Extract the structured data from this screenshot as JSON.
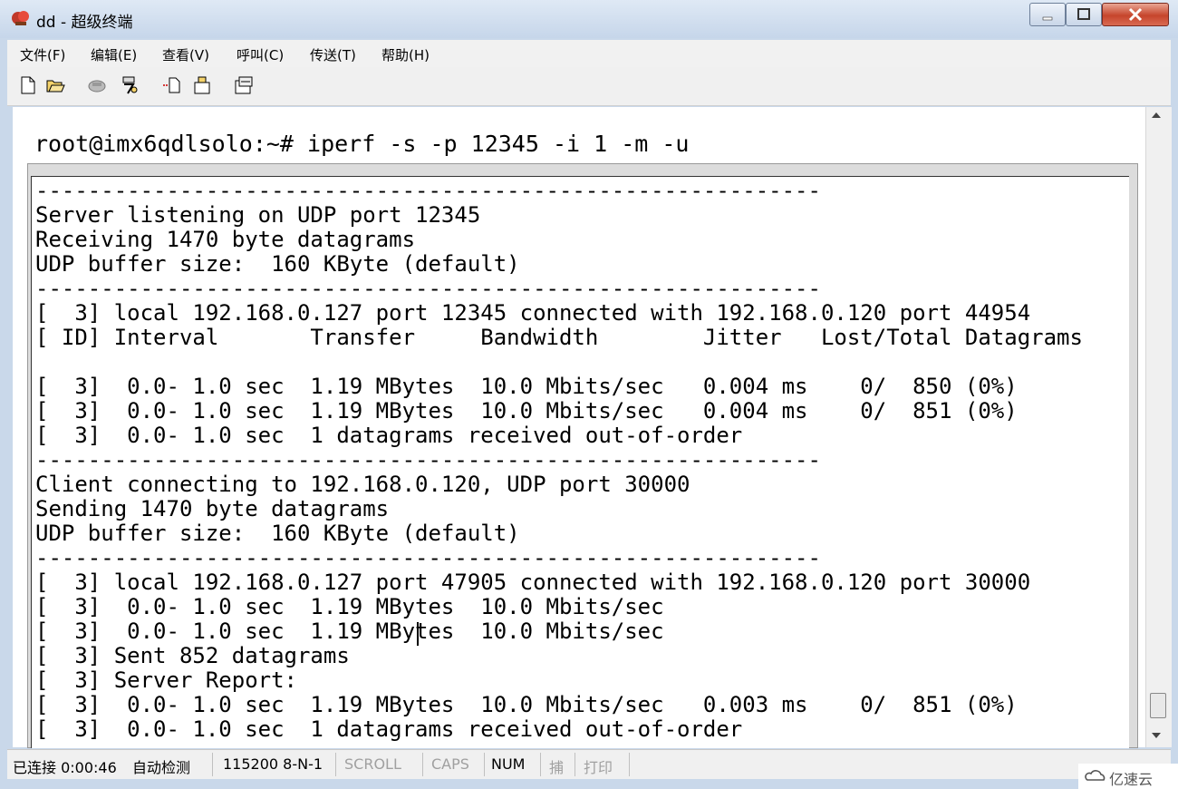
{
  "window": {
    "title": "dd - 超级终端"
  },
  "menu": [
    "文件(F)",
    "编辑(E)",
    "查看(V)",
    "呼叫(C)",
    "传送(T)",
    "帮助(H)"
  ],
  "toolbar_icons": [
    "new-icon",
    "open-icon",
    "disconnect-icon",
    "call-icon",
    "send-icon",
    "receive-icon",
    "properties-icon"
  ],
  "terminal": {
    "command_line": "root@imx6qdlsolo:~# iperf -s -p 12345 -i 1 -m -u",
    "lines": [
      "------------------------------------------------------------",
      "Server listening on UDP port 12345",
      "Receiving 1470 byte datagrams",
      "UDP buffer size:  160 KByte (default)",
      "------------------------------------------------------------",
      "[  3] local 192.168.0.127 port 12345 connected with 192.168.0.120 port 44954",
      "[ ID] Interval       Transfer     Bandwidth        Jitter   Lost/Total Datagrams",
      "",
      "[  3]  0.0- 1.0 sec  1.19 MBytes  10.0 Mbits/sec   0.004 ms    0/  850 (0%)",
      "[  3]  0.0- 1.0 sec  1.19 MBytes  10.0 Mbits/sec   0.004 ms    0/  851 (0%)",
      "[  3]  0.0- 1.0 sec  1 datagrams received out-of-order",
      "------------------------------------------------------------",
      "Client connecting to 192.168.0.120, UDP port 30000",
      "Sending 1470 byte datagrams",
      "UDP buffer size:  160 KByte (default)",
      "------------------------------------------------------------",
      "[  3] local 192.168.0.127 port 47905 connected with 192.168.0.120 port 30000",
      "[  3]  0.0- 1.0 sec  1.19 MBytes  10.0 Mbits/sec",
      "[  3]  0.0- 1.0 sec  1.19 MBytes  10.0 Mbits/sec",
      "[  3] Sent 852 datagrams",
      "[  3] Server Report:",
      "[  3]  0.0- 1.0 sec  1.19 MBytes  10.0 Mbits/sec   0.003 ms    0/  851 (0%)",
      "[  3]  0.0- 1.0 sec  1 datagrams received out-of-order"
    ]
  },
  "status": {
    "connected": "已连接 0:00:46",
    "detect": "自动检测",
    "serial": "115200 8-N-1",
    "scroll": "SCROLL",
    "caps": "CAPS",
    "num": "NUM",
    "capture": "捕",
    "print": "打印"
  },
  "watermark": "亿速云"
}
